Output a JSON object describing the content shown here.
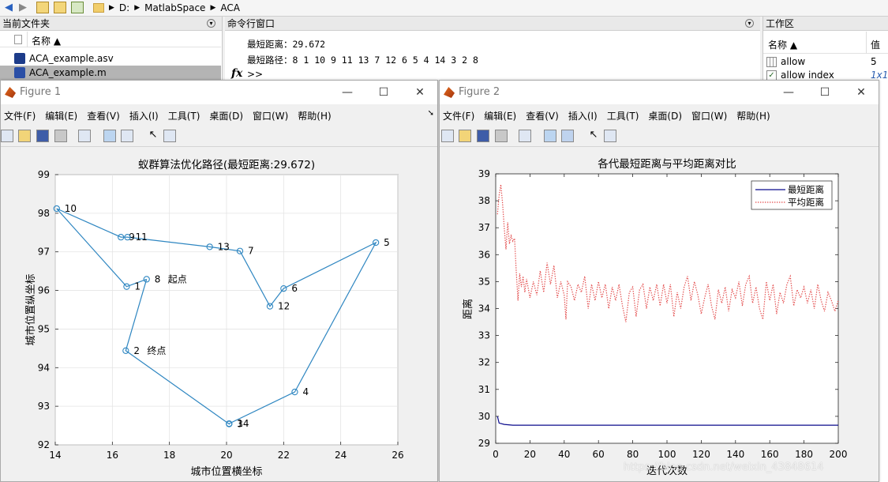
{
  "addressbar": {
    "crumbs": [
      "D:",
      "MatlabSpace",
      "ACA"
    ]
  },
  "files": {
    "title": "当前文件夹",
    "col": "名称 ▲",
    "items": [
      "ACA_example.asv",
      "ACA_example.m"
    ]
  },
  "cmd": {
    "title": "命令行窗口",
    "line1": "最短距离：29.672",
    "line2": "最短路径：8    1   10    9   11   13    7   12    6    5    4   14    3    2    8",
    "prompt": ">>"
  },
  "ws": {
    "title": "工作区",
    "col_name": "名称 ▲",
    "col_val": "值",
    "rows": [
      {
        "name": "allow",
        "val": "5"
      },
      {
        "name": "allow index",
        "val": "1x1"
      }
    ]
  },
  "menus": [
    "文件(F)",
    "编辑(E)",
    "查看(V)",
    "插入(I)",
    "工具(T)",
    "桌面(D)",
    "窗口(W)",
    "帮助(H)"
  ],
  "fig1": {
    "title": "Figure 1",
    "chart_data": {
      "type": "line",
      "title": "蚁群算法优化路径(最短距离:29.672)",
      "xlabel": "城市位置横坐标",
      "ylabel": "城市位置纵坐标",
      "xlim": [
        14,
        26
      ],
      "ylim": [
        92,
        99
      ],
      "xticks": [
        14,
        16,
        18,
        20,
        22,
        24,
        26
      ],
      "yticks": [
        92,
        93,
        94,
        95,
        96,
        97,
        98,
        99
      ],
      "grid": true,
      "cities": [
        {
          "id": "1",
          "x": 16.5,
          "y": 96.1
        },
        {
          "id": "2",
          "x": 16.47,
          "y": 94.44
        },
        {
          "id": "3",
          "x": 20.09,
          "y": 92.54
        },
        {
          "id": "4",
          "x": 22.39,
          "y": 93.37
        },
        {
          "id": "5",
          "x": 25.23,
          "y": 97.24
        },
        {
          "id": "6",
          "x": 22.0,
          "y": 96.05
        },
        {
          "id": "7",
          "x": 20.47,
          "y": 97.02
        },
        {
          "id": "8",
          "x": 17.2,
          "y": 96.29
        },
        {
          "id": "9",
          "x": 16.3,
          "y": 97.38
        },
        {
          "id": "10",
          "x": 14.05,
          "y": 98.12
        },
        {
          "id": "11",
          "x": 16.53,
          "y": 97.38
        },
        {
          "id": "12",
          "x": 21.52,
          "y": 95.59
        },
        {
          "id": "13",
          "x": 19.41,
          "y": 97.13
        },
        {
          "id": "14",
          "x": 20.09,
          "y": 92.55
        }
      ],
      "route": [
        "8",
        "1",
        "10",
        "9",
        "11",
        "13",
        "7",
        "12",
        "6",
        "5",
        "4",
        "14",
        "3",
        "2",
        "8"
      ],
      "annotations": [
        {
          "at": "8",
          "text": "起点"
        },
        {
          "at": "2",
          "text": "终点"
        }
      ]
    }
  },
  "fig2": {
    "title": "Figure 2",
    "chart_data": {
      "type": "line",
      "title": "各代最短距离与平均距离对比",
      "xlabel": "迭代次数",
      "ylabel": "距离",
      "xlim": [
        0,
        200
      ],
      "ylim": [
        29,
        39
      ],
      "xticks": [
        0,
        20,
        40,
        60,
        80,
        100,
        120,
        140,
        160,
        180,
        200
      ],
      "yticks": [
        29,
        30,
        31,
        32,
        33,
        34,
        35,
        36,
        37,
        38,
        39
      ],
      "legend_position": "top-right",
      "series": [
        {
          "name": "最短距离",
          "color": "#0a0a8c",
          "style": "solid",
          "points": [
            [
              1,
              30.0
            ],
            [
              2,
              29.75
            ],
            [
              5,
              29.7
            ],
            [
              10,
              29.672
            ],
            [
              200,
              29.672
            ]
          ]
        },
        {
          "name": "平均距离",
          "color": "#e34b4b",
          "style": "dotted",
          "points": [
            [
              1,
              37.5
            ],
            [
              2,
              38.2
            ],
            [
              3,
              38.6
            ],
            [
              4,
              37.9
            ],
            [
              5,
              37.0
            ],
            [
              6,
              36.2
            ],
            [
              7,
              37.2
            ],
            [
              8,
              36.4
            ],
            [
              9,
              36.7
            ],
            [
              10,
              36.5
            ],
            [
              11,
              36.6
            ],
            [
              12,
              35.4
            ],
            [
              13,
              34.3
            ],
            [
              14,
              35.3
            ],
            [
              15,
              34.8
            ],
            [
              16,
              35.2
            ],
            [
              17,
              34.6
            ],
            [
              18,
              35.1
            ],
            [
              20,
              34.4
            ],
            [
              22,
              35.0
            ],
            [
              24,
              34.5
            ],
            [
              26,
              35.4
            ],
            [
              28,
              34.6
            ],
            [
              30,
              35.7
            ],
            [
              32,
              34.9
            ],
            [
              34,
              35.6
            ],
            [
              36,
              34.4
            ],
            [
              38,
              35.0
            ],
            [
              40,
              34.5
            ],
            [
              41,
              33.6
            ],
            [
              42,
              35.0
            ],
            [
              44,
              34.8
            ],
            [
              46,
              34.3
            ],
            [
              48,
              34.9
            ],
            [
              50,
              34.6
            ],
            [
              52,
              35.2
            ],
            [
              54,
              34.0
            ],
            [
              56,
              34.9
            ],
            [
              58,
              34.3
            ],
            [
              60,
              35.0
            ],
            [
              62,
              34.4
            ],
            [
              64,
              34.9
            ],
            [
              66,
              34.0
            ],
            [
              68,
              34.8
            ],
            [
              70,
              34.3
            ],
            [
              72,
              34.9
            ],
            [
              74,
              34.1
            ],
            [
              76,
              33.5
            ],
            [
              78,
              34.6
            ],
            [
              80,
              34.8
            ],
            [
              82,
              33.7
            ],
            [
              84,
              34.7
            ],
            [
              86,
              34.9
            ],
            [
              88,
              34.0
            ],
            [
              90,
              34.8
            ],
            [
              92,
              34.3
            ],
            [
              94,
              34.9
            ],
            [
              96,
              34.1
            ],
            [
              98,
              34.9
            ],
            [
              100,
              34.2
            ],
            [
              102,
              34.9
            ],
            [
              104,
              33.7
            ],
            [
              106,
              34.6
            ],
            [
              108,
              34.0
            ],
            [
              110,
              34.8
            ],
            [
              112,
              35.2
            ],
            [
              114,
              34.3
            ],
            [
              116,
              35.0
            ],
            [
              118,
              34.5
            ],
            [
              120,
              33.8
            ],
            [
              122,
              34.4
            ],
            [
              124,
              34.9
            ],
            [
              126,
              34.1
            ],
            [
              128,
              33.6
            ],
            [
              130,
              34.7
            ],
            [
              132,
              34.2
            ],
            [
              134,
              34.8
            ],
            [
              136,
              33.9
            ],
            [
              138,
              34.7
            ],
            [
              140,
              34.4
            ],
            [
              142,
              35.0
            ],
            [
              144,
              34.1
            ],
            [
              146,
              34.9
            ],
            [
              148,
              35.2
            ],
            [
              150,
              34.2
            ],
            [
              152,
              34.8
            ],
            [
              154,
              34.0
            ],
            [
              156,
              33.6
            ],
            [
              158,
              35.0
            ],
            [
              160,
              34.3
            ],
            [
              162,
              34.9
            ],
            [
              164,
              33.8
            ],
            [
              166,
              34.6
            ],
            [
              168,
              34.2
            ],
            [
              170,
              34.9
            ],
            [
              172,
              35.2
            ],
            [
              174,
              34.1
            ],
            [
              176,
              34.7
            ],
            [
              178,
              34.4
            ],
            [
              180,
              34.8
            ],
            [
              182,
              34.2
            ],
            [
              184,
              34.7
            ],
            [
              186,
              34.0
            ],
            [
              188,
              34.9
            ],
            [
              190,
              34.3
            ],
            [
              192,
              33.9
            ],
            [
              194,
              34.6
            ],
            [
              196,
              34.3
            ],
            [
              198,
              33.9
            ],
            [
              200,
              34.3
            ]
          ]
        }
      ]
    }
  },
  "watermark": "https://blog.csdn.net/weixin_43848614"
}
